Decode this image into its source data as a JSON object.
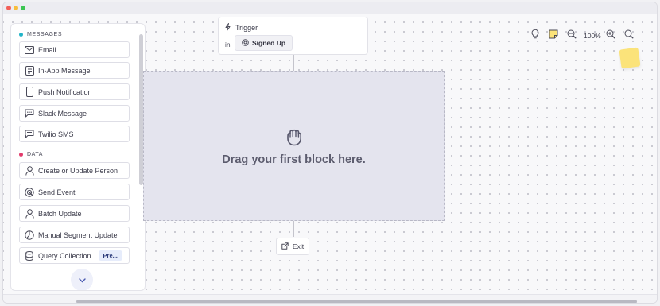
{
  "sidebar": {
    "sections": [
      {
        "title": "MESSAGES",
        "color": "#22b4c8"
      },
      {
        "title": "DATA",
        "color": "#e23a6b"
      }
    ],
    "messages": [
      {
        "label": "Email",
        "icon": "mail-icon"
      },
      {
        "label": "In-App Message",
        "icon": "in-app-message-icon"
      },
      {
        "label": "Push Notification",
        "icon": "mobile-phone-icon"
      },
      {
        "label": "Slack Message",
        "icon": "chat-bubble-icon"
      },
      {
        "label": "Twilio SMS",
        "icon": "sms-icon"
      }
    ],
    "data": [
      {
        "label": "Create or Update Person",
        "icon": "person-icon"
      },
      {
        "label": "Send Event",
        "icon": "send-event-icon"
      },
      {
        "label": "Batch Update",
        "icon": "person-icon"
      },
      {
        "label": "Manual Segment Update",
        "icon": "segment-icon"
      },
      {
        "label": "Query Collection",
        "icon": "database-icon",
        "badge": "Pre..."
      }
    ]
  },
  "trigger": {
    "title": "Trigger",
    "in_label": "in",
    "event": "Signed Up"
  },
  "dropzone": {
    "text": "Drag your first block here."
  },
  "exit": {
    "label": "Exit"
  },
  "toolbar": {
    "zoom": "100%"
  },
  "colors": {
    "sticky_note": "#fbe37a",
    "dropzone": "#e4e4ee"
  }
}
